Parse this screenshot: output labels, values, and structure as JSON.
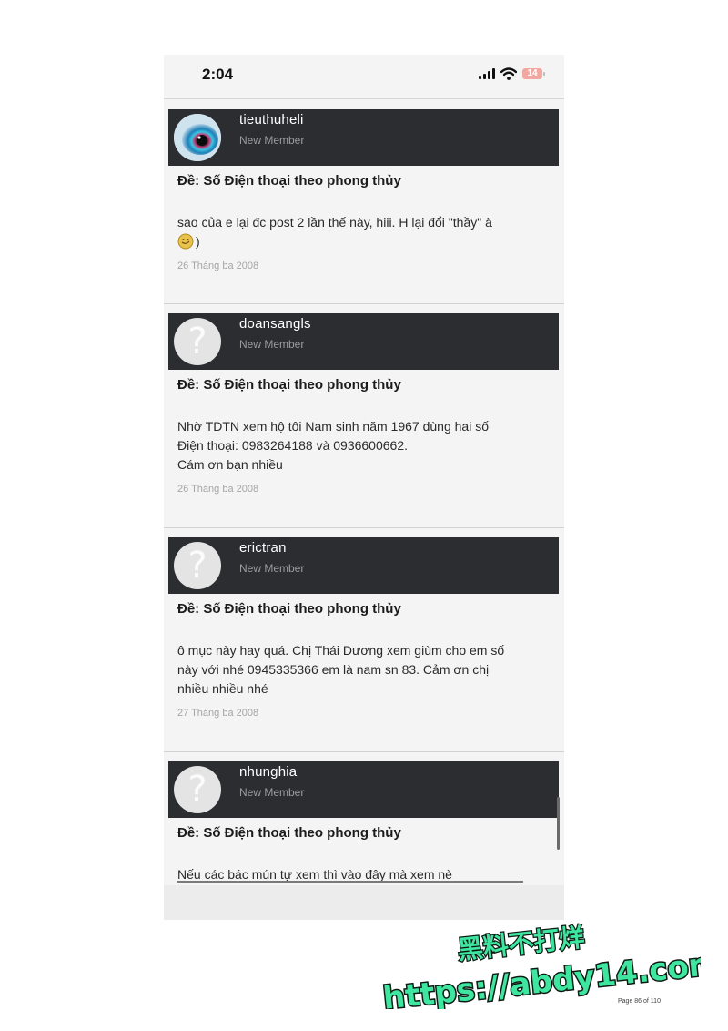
{
  "status": {
    "time": "2:04",
    "battery": "14"
  },
  "posts": [
    {
      "username": "tieuthuheli",
      "role": "New Member",
      "subject": "Đề: Số Điện thoại theo phong thủy",
      "lines": [
        "sao của e lại đc post 2 lần thế này, hiii. H lại đổi \"thầy\" à",
        ")"
      ],
      "date": "26 Tháng ba 2008"
    },
    {
      "username": "doansangls",
      "role": "New Member",
      "subject": "Đề: Số Điện thoại theo phong thủy",
      "lines": [
        "Nhờ TDTN xem hộ tôi Nam sinh năm 1967 dùng hai số",
        "Điện thoại: 0983264188 và 0936600662.",
        "Cám ơn bạn nhiều"
      ],
      "date": "26 Tháng ba 2008"
    },
    {
      "username": "erictran",
      "role": "New Member",
      "subject": "Đề: Số Điện thoại theo phong thủy",
      "lines": [
        "ô mục này hay quá. Chị Thái Dương xem giùm cho em số",
        "này với nhé 0945335366 em là nam sn 83. Cảm ơn chị",
        "nhiều nhiều nhé"
      ],
      "date": "27 Tháng ba 2008"
    },
    {
      "username": "nhunghia",
      "role": "New Member",
      "subject": "Đề: Số Điện thoại theo phong thủy",
      "lines": [
        "Nếu các bác mún tự xem thì vào đây mà xem nè"
      ]
    }
  ],
  "watermark": {
    "line1": "黑料不打烊",
    "line2": "https://abdy14.com"
  },
  "page_number": "Page 86 of 110",
  "colors": {
    "user_bar": "#2c2d31",
    "watermark_fill": "#3ee6a0",
    "watermark_outline": "#0d1b14"
  }
}
